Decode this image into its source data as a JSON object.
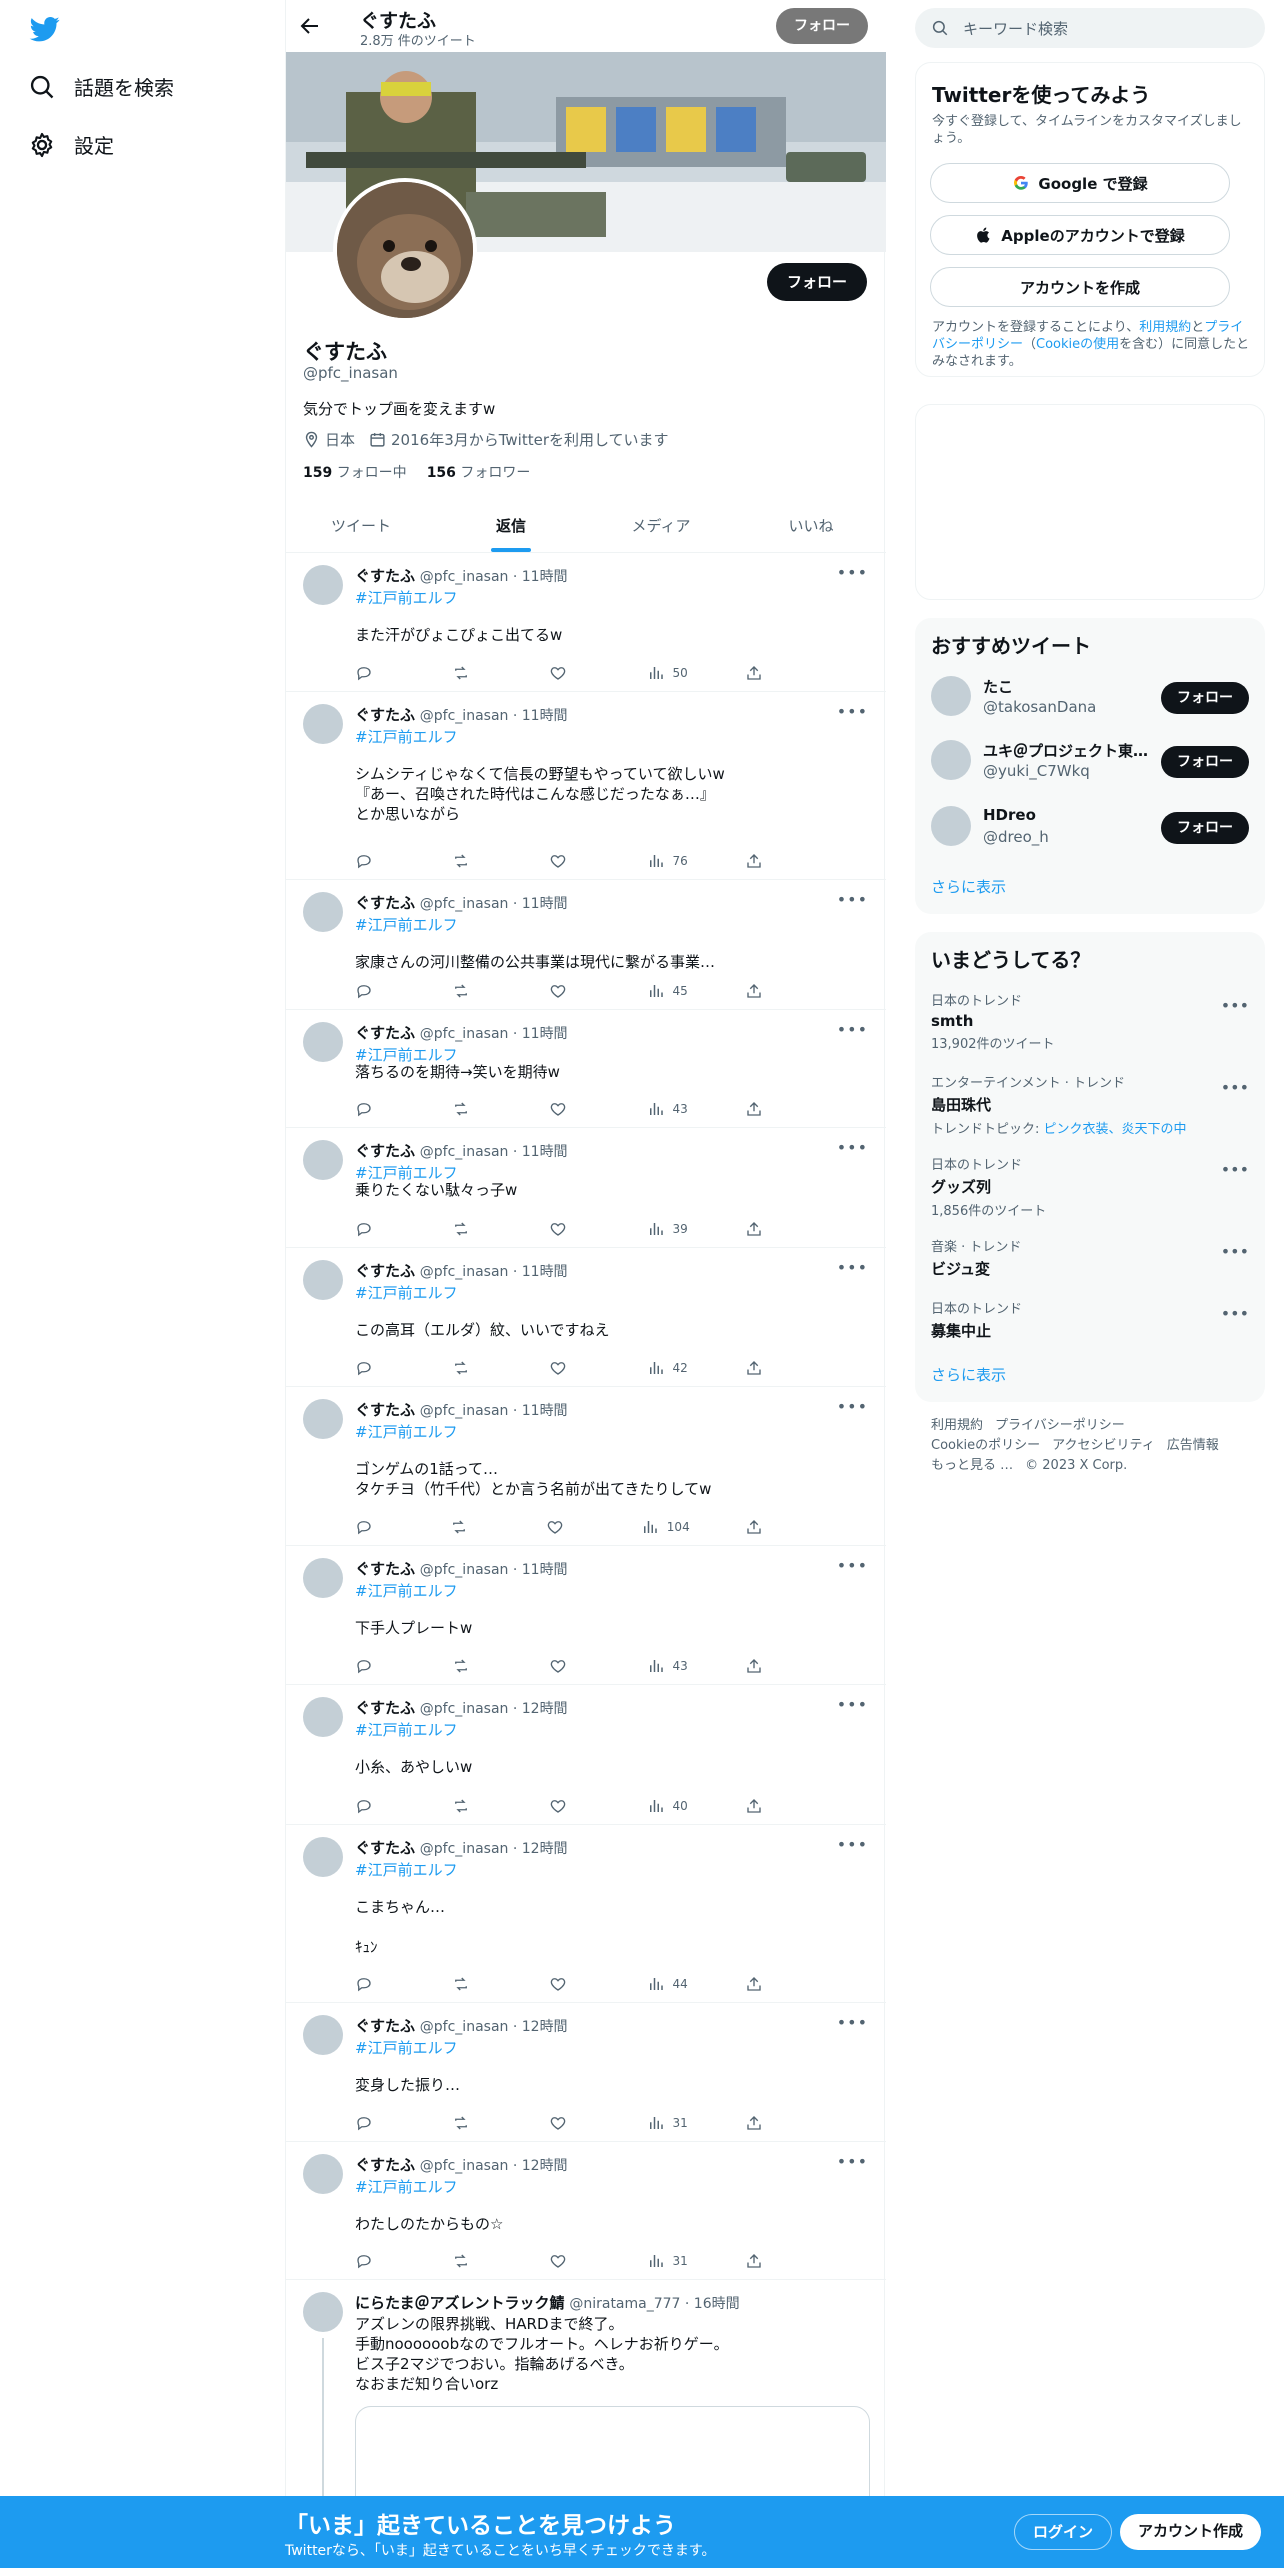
{
  "nav": {
    "explore_label": "話題を検索",
    "settings_label": "設定"
  },
  "profile": {
    "top_name": "ぐすたふ",
    "tweet_count": "2.8万 件のツイート",
    "top_follow_label": "フォロー",
    "follow_label": "フォロー",
    "name": "ぐすたふ",
    "handle": "@pfc_inasan",
    "bio": "気分でトップ画を変えますw",
    "location": "日本",
    "joined": "2016年3月からTwitterを利用しています",
    "following_count": "159",
    "following_label": "フォロー中",
    "followers_count": "156",
    "followers_label": "フォロワー"
  },
  "tabs": [
    "ツイート",
    "返信",
    "メディア",
    "いいね"
  ],
  "active_tab": 1,
  "tweets": [
    {
      "name": "ぐすたふ",
      "meta": "@pfc_inasan · 11時間",
      "tag": "#江戸前エルフ",
      "text": "また汗がぴょこぴょこ出てるw",
      "views": "50"
    },
    {
      "name": "ぐすたふ",
      "meta": "@pfc_inasan · 11時間",
      "tag": "#江戸前エルフ",
      "text": "シムシティじゃなくて信長の野望もやっていて欲しいw\n『あー、召喚された時代はこんな感じだったなぁ…』\nとか思いながら",
      "views": "76"
    },
    {
      "name": "ぐすたふ",
      "meta": "@pfc_inasan · 11時間",
      "tag": "#江戸前エルフ",
      "text": "家康さんの河川整備の公共事業は現代に繋がる事業…",
      "views": "45"
    },
    {
      "name": "ぐすたふ",
      "meta": "@pfc_inasan · 11時間",
      "tag": "#江戸前エルフ",
      "text": "落ちるのを期待→笑いを期待w",
      "views": "43"
    },
    {
      "name": "ぐすたふ",
      "meta": "@pfc_inasan · 11時間",
      "tag": "#江戸前エルフ",
      "text": "乗りたくない駄々っ子w",
      "views": "39"
    },
    {
      "name": "ぐすたふ",
      "meta": "@pfc_inasan · 11時間",
      "tag": "#江戸前エルフ",
      "text": "この高耳（エルダ）紋、いいですねえ",
      "views": "42"
    },
    {
      "name": "ぐすたふ",
      "meta": "@pfc_inasan · 11時間",
      "tag": "#江戸前エルフ",
      "text": "ゴンゲムの1話って…\nタケチヨ（竹千代）とか言う名前が出てきたりしてw",
      "views": "104"
    },
    {
      "name": "ぐすたふ",
      "meta": "@pfc_inasan · 11時間",
      "tag": "#江戸前エルフ",
      "text": "下手人プレートw",
      "views": "43"
    },
    {
      "name": "ぐすたふ",
      "meta": "@pfc_inasan · 12時間",
      "tag": "#江戸前エルフ",
      "text": "小糸、あやしいw",
      "views": "40"
    },
    {
      "name": "ぐすたふ",
      "meta": "@pfc_inasan · 12時間",
      "tag": "#江戸前エルフ",
      "text": "こまちゃん…\n\nｷｭﾝ",
      "views": "44"
    },
    {
      "name": "ぐすたふ",
      "meta": "@pfc_inasan · 12時間",
      "tag": "#江戸前エルフ",
      "text": "変身した振り…",
      "views": "31"
    },
    {
      "name": "ぐすたふ",
      "meta": "@pfc_inasan · 12時間",
      "tag": "#江戸前エルフ",
      "text": "わたしのたからもの☆",
      "views": "31"
    }
  ],
  "thread_tweet": {
    "name": "にらたま＠アズレントラック鯖",
    "meta": "@niratama_777 · 16時間",
    "text": "アズレンの限界挑戦、HARDまで終了。\n手動noooooobなのでフルオート。ヘレナお祈りゲー。\nビス子2マジでつおい。指輪あげるべき。\nなおまだ知り合いorz"
  },
  "right": {
    "search_placeholder": "キーワード検索",
    "signup_title": "Twitterを使ってみよう",
    "signup_desc": "今すぐ登録して、タイムラインをカスタマイズしましょう。",
    "google_label": "Google で登録",
    "apple_label": "Appleのアカウントで登録",
    "create_label": "アカウントを作成",
    "legal_1": "アカウントを登録することにより、",
    "legal_terms": "利用規約",
    "legal_2": "と",
    "legal_privacy": "プライバシーポリシー",
    "legal_3": "（",
    "legal_cookie": "Cookieの使用",
    "legal_4": "を含む）に同意したとみなされます。",
    "recom_title": "おすすめツイート",
    "recom_users": [
      {
        "name": "たこ",
        "handle": "@takosanDana",
        "btn": "フォロー"
      },
      {
        "name": "ユキ＠プロジェクト東…",
        "handle": "@yuki_C7Wkq",
        "btn": "フォロー"
      },
      {
        "name": "HDreo",
        "handle": "@dreo_h",
        "btn": "フォロー"
      }
    ],
    "show_more": "さらに表示",
    "trends_title": "いまどうしてる？",
    "trends": [
      {
        "context": "日本のトレンド",
        "name": "smth",
        "sub": "13,902件のツイート"
      },
      {
        "context": "エンターテインメント · トレンド",
        "name": "島田珠代",
        "sub_prefix": "トレンドトピック: ",
        "sub_link": "ピンク衣装、炎天下の中"
      },
      {
        "context": "日本のトレンド",
        "name": "グッズ列",
        "sub": "1,856件のツイート"
      },
      {
        "context": "音楽 · トレンド",
        "name": "ビジュ変",
        "sub": ""
      },
      {
        "context": "日本のトレンド",
        "name": "募集中止",
        "sub": ""
      }
    ],
    "trends_show_more": "さらに表示",
    "footer": [
      "利用規約",
      "プライバシーポリシー",
      "Cookieのポリシー",
      "アクセシビリティ",
      "広告情報",
      "もっと見る …",
      "© 2023 X Corp."
    ]
  },
  "bottom": {
    "title": "「いま」起きていることを見つけよう",
    "subtitle": "Twitterなら、「いま」起きていることをいち早くチェックできます。",
    "login": "ログイン",
    "signup": "アカウント作成"
  },
  "colors": {
    "accent": "#1d9bf0",
    "text": "#0f1419",
    "muted": "#536471",
    "bottom_bar": "#1d9bf0"
  }
}
